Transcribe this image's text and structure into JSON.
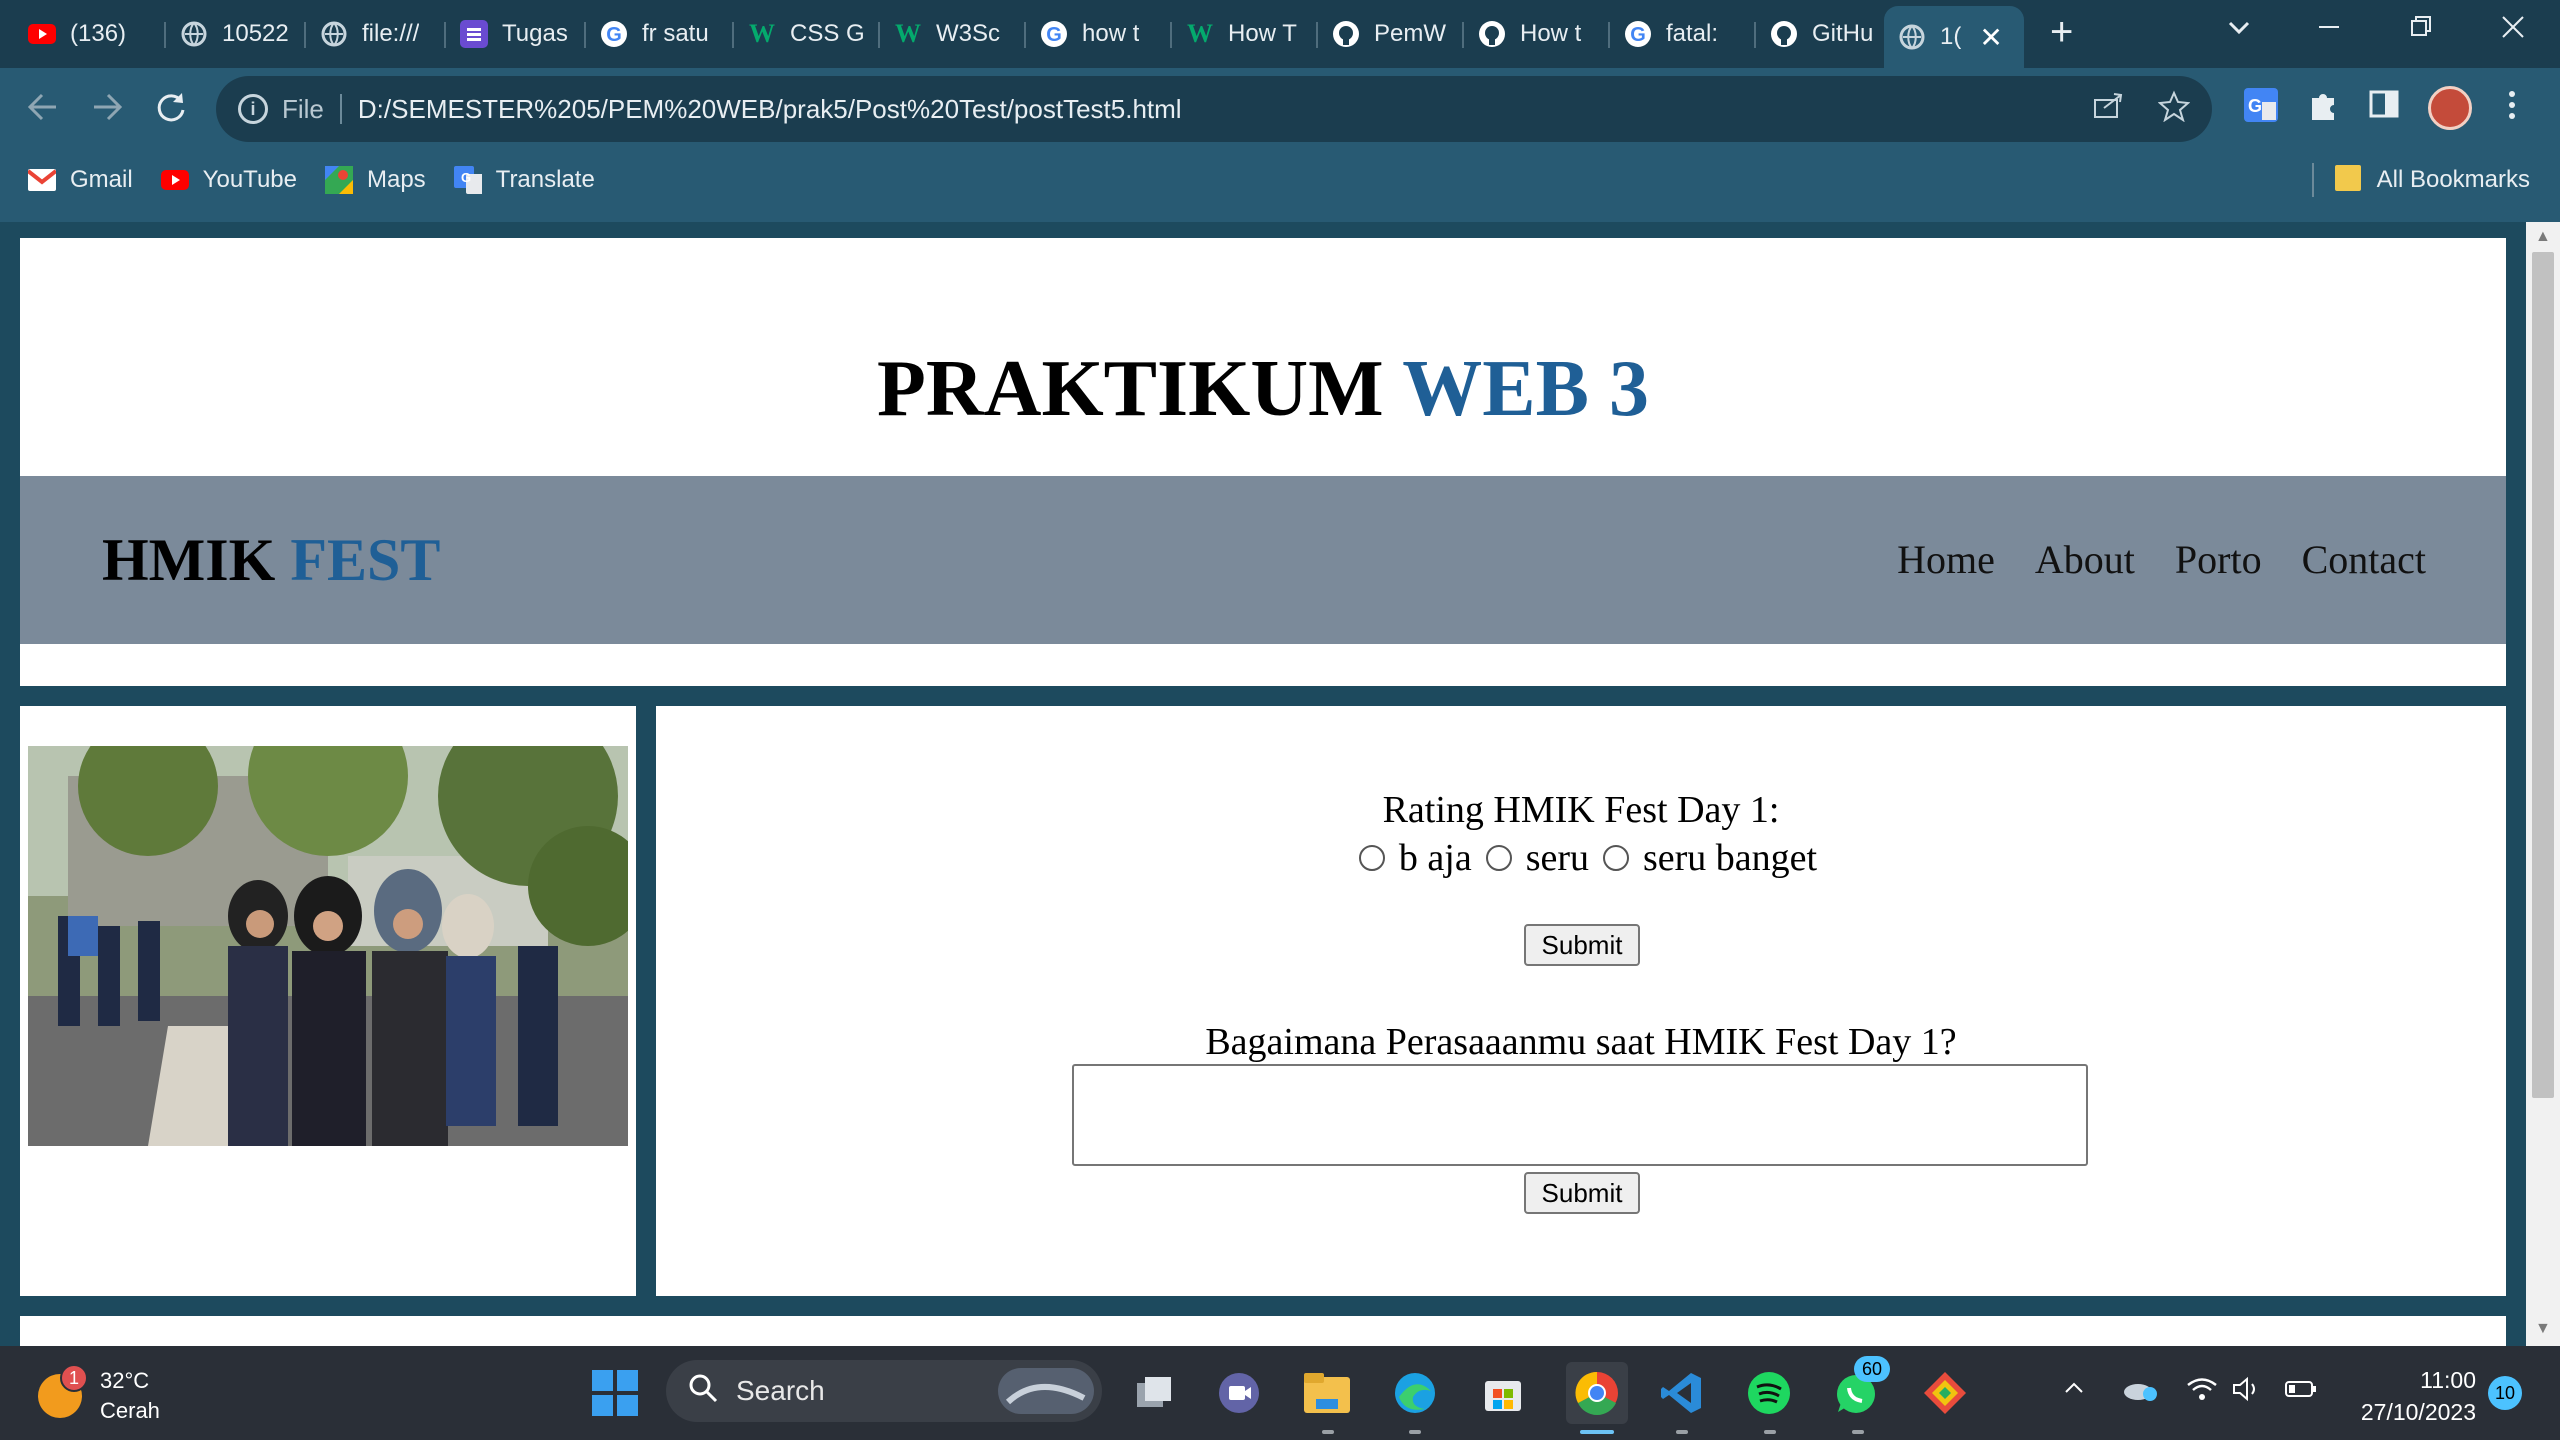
{
  "browser": {
    "tabs": [
      {
        "title": "(136)",
        "icon": "youtube-icon"
      },
      {
        "title": "10522",
        "icon": "globe-icon"
      },
      {
        "title": "file:///",
        "icon": "globe-icon"
      },
      {
        "title": "Tugas",
        "icon": "list-icon"
      },
      {
        "title": "fr satu",
        "icon": "google-icon"
      },
      {
        "title": "CSS G",
        "icon": "w3schools-icon"
      },
      {
        "title": "W3Sc",
        "icon": "w3schools-icon"
      },
      {
        "title": "how t",
        "icon": "google-icon"
      },
      {
        "title": "How T",
        "icon": "w3schools-icon"
      },
      {
        "title": "PemW",
        "icon": "github-icon"
      },
      {
        "title": "How t",
        "icon": "github-icon"
      },
      {
        "title": "fatal:",
        "icon": "google-icon"
      },
      {
        "title": "GitHu",
        "icon": "github-icon"
      },
      {
        "title": "1(",
        "icon": "globe-icon",
        "active": true
      }
    ],
    "address": {
      "scheme_label": "File",
      "url": "D:/SEMESTER%205/PEM%20WEB/prak5/Post%20Test/postTest5.html"
    },
    "bookmarks": [
      {
        "label": "Gmail",
        "icon": "gmail-icon"
      },
      {
        "label": "YouTube",
        "icon": "youtube-icon"
      },
      {
        "label": "Maps",
        "icon": "maps-icon"
      },
      {
        "label": "Translate",
        "icon": "translate-icon"
      }
    ],
    "all_bookmarks_label": "All Bookmarks"
  },
  "page": {
    "title_main": "PRAKTIKUM",
    "title_accent": "WEB 3",
    "brand_main": "HMIK",
    "brand_accent": "FEST",
    "nav": [
      "Home",
      "About",
      "Porto",
      "Contact"
    ],
    "rating_question": "Rating HMIK Fest Day 1:",
    "rating_options": [
      "b aja",
      "seru",
      "seru banget"
    ],
    "submit_label": "Submit",
    "feeling_question": "Bagaimana Perasaaanmu saat HMIK Fest Day 1?",
    "feeling_value": "",
    "accent_color": "#1f5f96",
    "nav_bg_color": "#7b8a9a"
  },
  "taskbar": {
    "weather_temp": "32°C",
    "weather_desc": "Cerah",
    "weather_badge": "1",
    "search_label": "Search",
    "whatsapp_badge": "60",
    "time": "11:00",
    "date": "27/10/2023",
    "notification_count": "10"
  }
}
